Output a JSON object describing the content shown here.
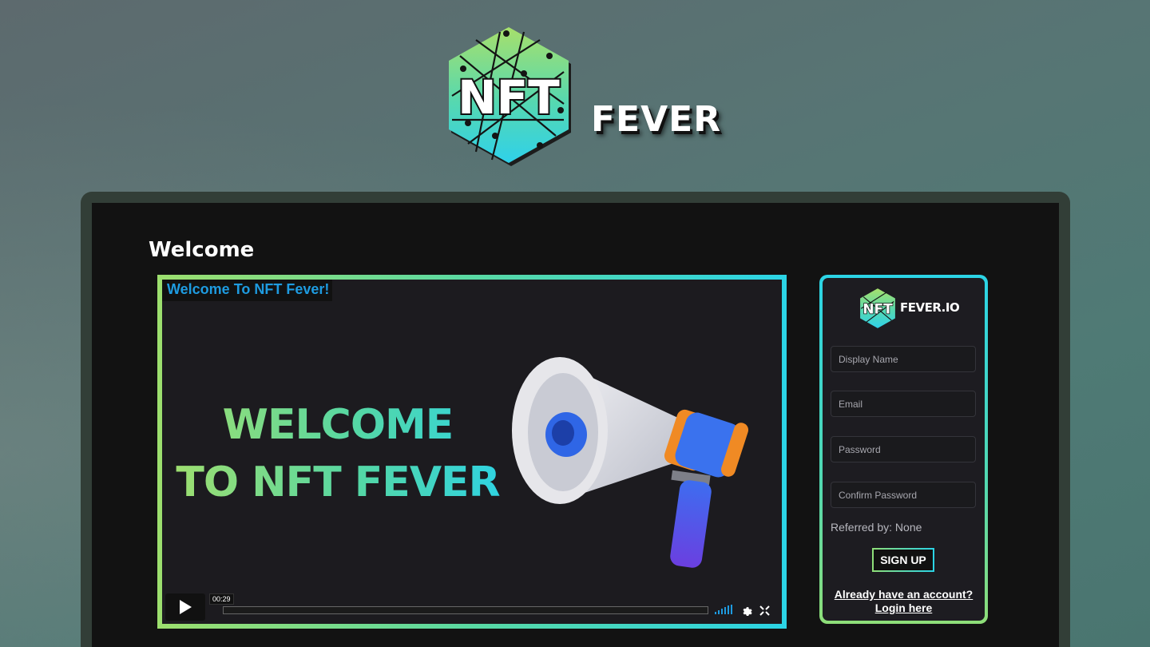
{
  "brand": {
    "logo_mark": "NFT",
    "name": "FEVER",
    "icon": "nft-hexagon-logo-icon"
  },
  "page": {
    "heading": "Welcome"
  },
  "video": {
    "caption": "Welcome To NFT Fever!",
    "headline_line1": "WELCOME",
    "headline_line2": "TO NFT FEVER",
    "timestamp": "00:29",
    "icons": {
      "play": "play-icon",
      "volume": "volume-icon",
      "settings": "gear-icon",
      "fullscreen": "fullscreen-icon"
    }
  },
  "signup": {
    "logo_mark": "NFT",
    "logo_text": "FEVER.IO",
    "display_name_placeholder": "Display Name",
    "email_placeholder": "Email",
    "password_placeholder": "Password",
    "confirm_password_placeholder": "Confirm Password",
    "referred_text": "Referred by: None",
    "submit_label": "SIGN UP",
    "login_line1": "Already have an account?",
    "login_line2": "Login here"
  },
  "colors": {
    "accent_green": "#9ddf6e",
    "accent_cyan": "#2bd4e6",
    "caption_blue": "#1e9be0",
    "screen_bg": "#121212"
  }
}
